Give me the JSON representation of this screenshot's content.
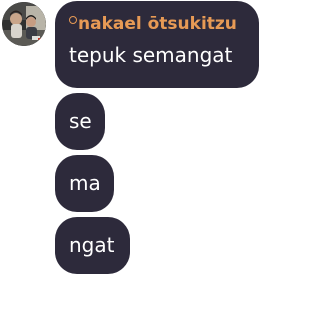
{
  "chat": {
    "avatar": "profile-photo",
    "sender_name": "nakael ōtsukitzu",
    "messages": [
      {
        "text": "tepuk semangat"
      },
      {
        "text": "se"
      },
      {
        "text": "ma"
      },
      {
        "text": "ngat"
      }
    ]
  },
  "colors": {
    "bubble": "#2d2a3b",
    "sender_name": "#e79a55",
    "message_text": "#ffffff",
    "background": "#ffffff"
  }
}
